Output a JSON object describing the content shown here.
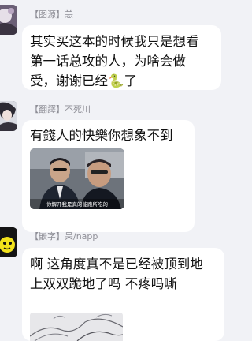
{
  "messages": [
    {
      "role": "【图源】",
      "user": "恙",
      "text": "其实买这本的时候我只是想看\n第一话总攻的人，为啥会做\n受，谢谢已经🐍了"
    },
    {
      "role": "【翻譯】",
      "user": "不死川",
      "text": "有錢人的快樂你想象不到",
      "image_caption": "你解开我是真的能跑所吃的"
    },
    {
      "role": "【嵌字】",
      "user": "呆/napp",
      "text": "啊 这角度真不是已经被顶到地\n上双双跪地了吗 不疼吗嘶"
    }
  ]
}
